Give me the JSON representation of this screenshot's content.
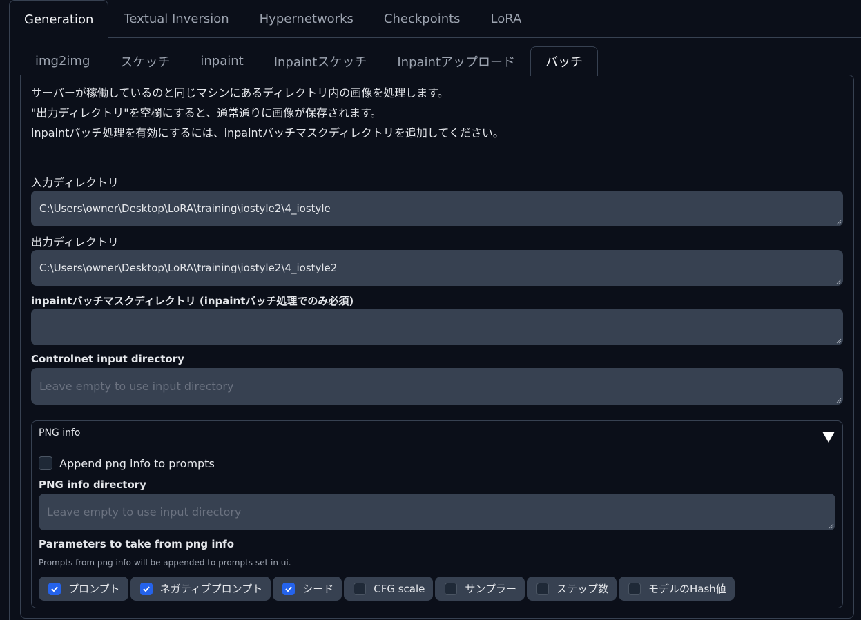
{
  "top_tabs": [
    "Generation",
    "Textual Inversion",
    "Hypernetworks",
    "Checkpoints",
    "LoRA"
  ],
  "sub_tabs": [
    "img2img",
    "スケッチ",
    "inpaint",
    "Inpaintスケッチ",
    "Inpaintアップロード",
    "バッチ"
  ],
  "description": [
    "サーバーが稼働しているのと同じマシンにあるディレクトリ内の画像を処理します。",
    "\"出力ディレクトリ\"を空欄にすると、通常通りに画像が保存されます。",
    "inpaintバッチ処理を有効にするには、inpaintバッチマスクディレクトリを追加してください。"
  ],
  "input_dir": {
    "label": "入力ディレクトリ",
    "value": "C:\\Users\\owner\\Desktop\\LoRA\\training\\iostyle2\\4_iostyle"
  },
  "output_dir": {
    "label": "出力ディレクトリ",
    "value": "C:\\Users\\owner\\Desktop\\LoRA\\training\\iostyle2\\4_iostyle2"
  },
  "mask_dir": {
    "label": "inpaintバッチマスクディレクトリ (inpaintバッチ処理でのみ必須)",
    "value": ""
  },
  "controlnet_dir": {
    "label": "Controlnet input directory",
    "placeholder": "Leave empty to use input directory"
  },
  "png_info": {
    "title": "PNG info",
    "append_label": "Append png info to prompts",
    "append_checked": false,
    "dir_label": "PNG info directory",
    "dir_placeholder": "Leave empty to use input directory",
    "params_label": "Parameters to take from png info",
    "params_hint": "Prompts from png info will be appended to prompts set in ui.",
    "params": [
      {
        "label": "プロンプト",
        "checked": true
      },
      {
        "label": "ネガティブプロンプト",
        "checked": true
      },
      {
        "label": "シード",
        "checked": true
      },
      {
        "label": "CFG scale",
        "checked": false
      },
      {
        "label": "サンプラー",
        "checked": false
      },
      {
        "label": "ステップ数",
        "checked": false
      },
      {
        "label": "モデルのHash値",
        "checked": false
      }
    ]
  },
  "colors": {
    "background": "#0b0f19",
    "input": "#374151",
    "accent": "#2563eb",
    "border": "#374151"
  }
}
